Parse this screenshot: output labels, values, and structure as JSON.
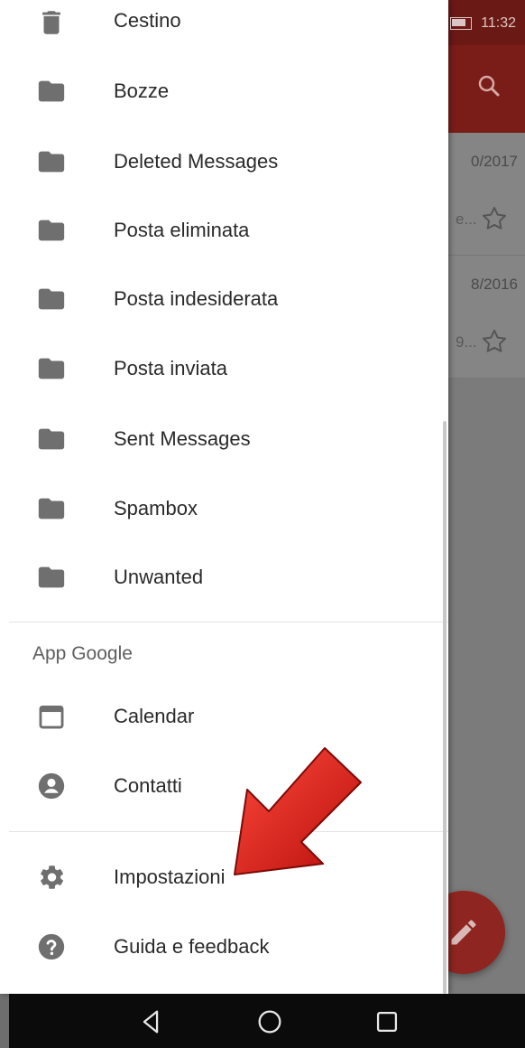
{
  "status_bar": {
    "battery_text": "78%",
    "time": "11:32"
  },
  "background_app": {
    "emails": [
      {
        "date": "0/2017",
        "snippet": "e..."
      },
      {
        "date": "8/2016",
        "snippet": "9..."
      }
    ]
  },
  "drawer": {
    "top_partial_item": {
      "label": "Cestino",
      "icon": "trash-icon"
    },
    "folders": [
      {
        "label": "Bozze",
        "icon": "folder-icon"
      },
      {
        "label": "Deleted Messages",
        "icon": "folder-icon"
      },
      {
        "label": "Posta eliminata",
        "icon": "folder-icon"
      },
      {
        "label": "Posta indesiderata",
        "icon": "folder-icon"
      },
      {
        "label": "Posta inviata",
        "icon": "folder-icon"
      },
      {
        "label": "Sent Messages",
        "icon": "folder-icon"
      },
      {
        "label": "Spambox",
        "icon": "folder-icon"
      },
      {
        "label": "Unwanted",
        "icon": "folder-icon"
      }
    ],
    "google_apps_header": "App Google",
    "google_apps": [
      {
        "label": "Calendar",
        "icon": "calendar-icon"
      },
      {
        "label": "Contatti",
        "icon": "contact-icon"
      }
    ],
    "bottom_items": [
      {
        "label": "Impostazioni",
        "icon": "gear-icon"
      },
      {
        "label": "Guida e feedback",
        "icon": "help-icon"
      }
    ]
  },
  "colors": {
    "toolbar_dimmed": "#7a1d18",
    "drawer_background": "#ffffff",
    "icon_gray": "#6f6f6f",
    "pointer_arrow": "#d8140f"
  }
}
